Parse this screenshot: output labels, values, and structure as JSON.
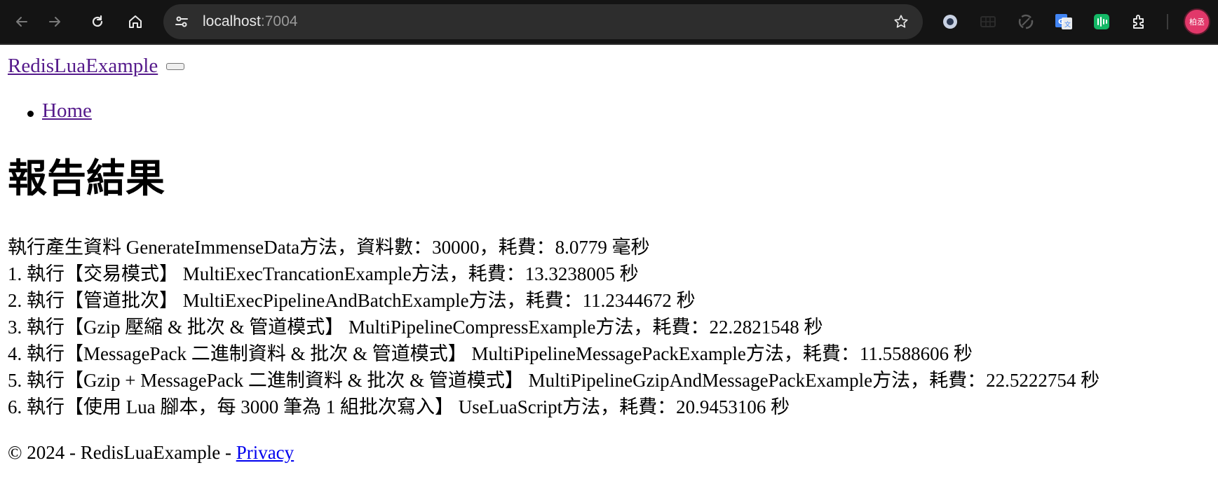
{
  "browser": {
    "url_host": "localhost",
    "url_port": ":7004",
    "profile_initials": "柏丞",
    "icons": [
      "back-icon",
      "forward-icon",
      "reload-icon",
      "home-icon",
      "site-info-icon",
      "bookmark-star-icon",
      "extension-icon"
    ]
  },
  "navbar": {
    "brand": "RedisLuaExample",
    "items": [
      {
        "label": "Home"
      }
    ]
  },
  "main": {
    "title": "報告結果",
    "lines": [
      "執行產生資料 GenerateImmenseData方法，資料數：30000，耗費：8.0779 毫秒",
      "1. 執行【交易模式】 MultiExecTrancationExample方法，耗費：13.3238005 秒",
      "2. 執行【管道批次】 MultiExecPipelineAndBatchExample方法，耗費：11.2344672 秒",
      "3. 執行【Gzip 壓縮 & 批次 & 管道模式】 MultiPipelineCompressExample方法，耗費：22.2821548 秒",
      "4. 執行【MessagePack 二進制資料 & 批次 & 管道模式】 MultiPipelineMessagePackExample方法，耗費：11.5588606 秒",
      "5. 執行【Gzip + MessagePack 二進制資料 & 批次 & 管道模式】 MultiPipelineGzipAndMessagePackExample方法，耗費：22.5222754 秒",
      "6. 執行【使用 Lua 腳本，每 3000 筆為 1 組批次寫入】 UseLuaScript方法，耗費：20.9453106 秒"
    ]
  },
  "footer": {
    "text": "© 2024 - RedisLuaExample - ",
    "privacy_link": "Privacy"
  },
  "colors": {
    "visited_link": "#551a8b",
    "link": "#0000ee",
    "chrome_bg": "#141414",
    "omnibox_bg": "#2d2d2d",
    "profile_bg": "#e1386a"
  }
}
